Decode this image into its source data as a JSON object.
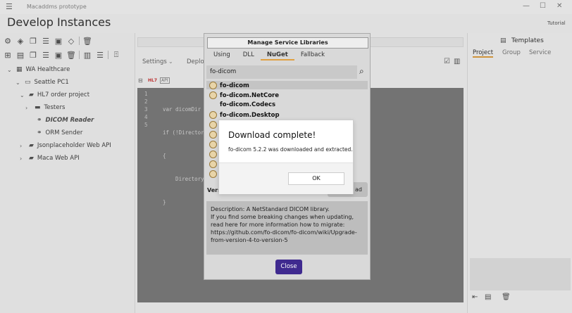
{
  "window": {
    "title": "Macaddms prototype",
    "page_title": "Develop Instances",
    "tutorial_label": "Tutorial",
    "minimize": "—",
    "maximize": "☐",
    "close": "✕"
  },
  "tree": [
    {
      "label": "WA Healthcare",
      "icon": "building-icon"
    },
    {
      "label": "Seattle PC1",
      "icon": "computer-icon"
    },
    {
      "label": "HL7 order project",
      "icon": "briefcase-icon"
    },
    {
      "label": "Testers",
      "icon": "folder-icon"
    },
    {
      "label": "DICOM Reader",
      "icon": "link-icon"
    },
    {
      "label": "ORM Sender",
      "icon": "link-icon"
    },
    {
      "label": "Jsonplaceholder Web API",
      "icon": "briefcase-icon"
    },
    {
      "label": "Maca Web API",
      "icon": "briefcase-icon"
    }
  ],
  "center": {
    "tab_settings": "Settings",
    "tab_deploy": "Deplo",
    "code_lines": [
      "1",
      "2",
      "3",
      "4",
      "5"
    ],
    "code": [
      "var dicomDir",
      "if (!Director",
      "{",
      "    Directory",
      "}"
    ]
  },
  "right": {
    "title": "Templates",
    "tabs": [
      "Project",
      "Group",
      "Service"
    ]
  },
  "dialog": {
    "title": "Manage Service Libraries",
    "tabs": [
      "Using",
      "DLL",
      "NuGet",
      "Fallback"
    ],
    "search_value": "fo-dicom",
    "results": [
      "fo-dicom",
      "fo-dicom.NetCore",
      "fo-dicom.Codecs",
      "fo-dicom.Desktop"
    ],
    "version_label": "Vers",
    "download_label": "ad",
    "description": "Description: A NetStandard DICOM library.\nIf you find some breaking changes when updating, read here for more information how to migrate: https://github.com/fo-dicom/fo-dicom/wiki/Upgrade-from-version-4-to-version-5",
    "close_label": "Close"
  },
  "toast": {
    "title": "Download complete!",
    "message": "fo-dicom 5.2.2 was downloaded and extracted.",
    "ok_label": "OK"
  },
  "colors": {
    "accent": "#e0a040",
    "primary_button": "#3f2a8f"
  }
}
